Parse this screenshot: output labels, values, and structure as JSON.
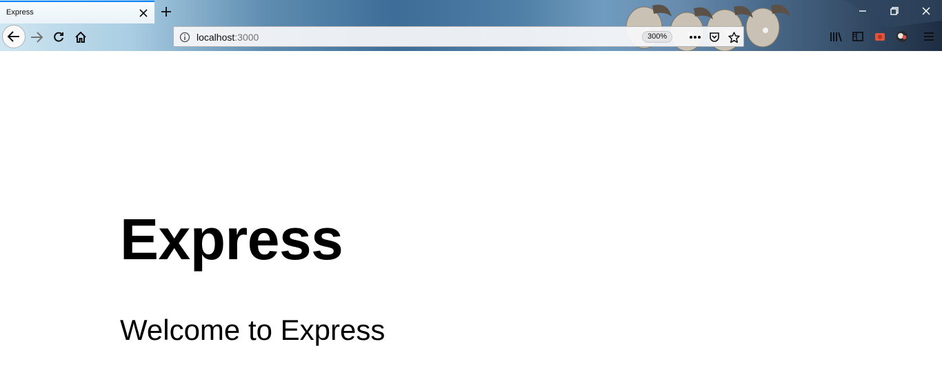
{
  "browser": {
    "tab": {
      "title": "Express"
    },
    "address_bar": {
      "host": "localhost",
      "port": ":3000",
      "zoom": "300%"
    },
    "icons": {
      "back": "back-arrow-icon",
      "forward": "forward-arrow-icon",
      "reload": "reload-icon",
      "home": "home-icon",
      "info": "info-icon",
      "page_actions": "more-dots-icon",
      "pocket": "pocket-icon",
      "bookmark": "star-icon",
      "library": "library-icon",
      "sidebar": "sidebar-icon",
      "extension": "extension-icon",
      "account": "account-icon",
      "menu": "hamburger-menu-icon"
    },
    "accent_color": "#0a84ff"
  },
  "page": {
    "heading": "Express",
    "welcome": "Welcome to Express"
  }
}
